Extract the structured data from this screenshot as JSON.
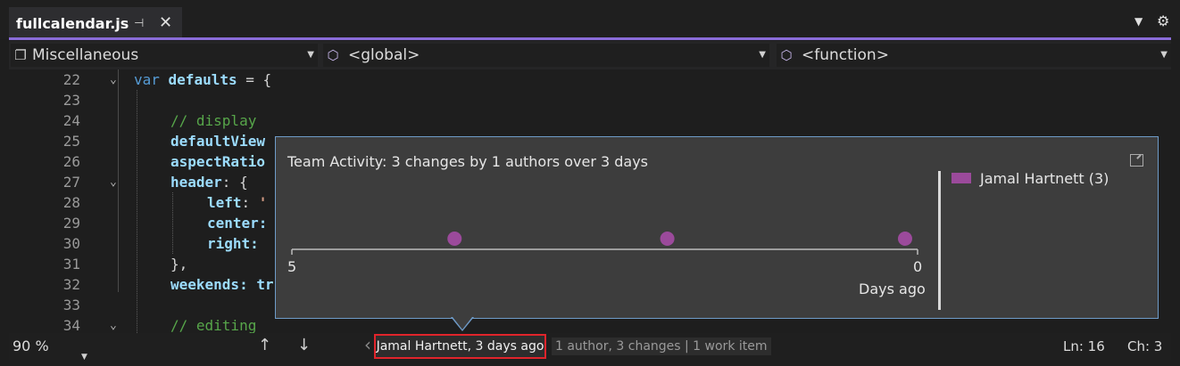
{
  "tab": {
    "title": "fullcalendar.js",
    "pin_icon": "pin-icon",
    "close_icon": "close-icon"
  },
  "toolbar_icons": [
    "dropdown-icon",
    "gear-icon"
  ],
  "navbar": {
    "project": "Miscellaneous",
    "scope": "<global>",
    "member": "<function>"
  },
  "editor": {
    "lines": [
      {
        "n": "22",
        "text": "var defaults = {"
      },
      {
        "n": "23",
        "text": ""
      },
      {
        "n": "24",
        "text": "// display"
      },
      {
        "n": "25",
        "text": "defaultView"
      },
      {
        "n": "26",
        "text": "aspectRatio"
      },
      {
        "n": "27",
        "text": "header: {"
      },
      {
        "n": "28",
        "text": "left: '"
      },
      {
        "n": "29",
        "text": "center:"
      },
      {
        "n": "30",
        "text": "right:"
      },
      {
        "n": "31",
        "text": "},"
      },
      {
        "n": "32",
        "text": "weekends: tr"
      },
      {
        "n": "33",
        "text": ""
      },
      {
        "n": "34",
        "text": "// editing"
      }
    ]
  },
  "popup": {
    "title": "Team Activity: 3 changes by 1 authors over 3 days",
    "legend": [
      {
        "label": "Jamal Hartnett (3)",
        "color": "#9b4a9b"
      }
    ]
  },
  "chart_data": {
    "type": "scatter",
    "title": "Team Activity: 3 changes by 1 authors over 3 days",
    "xlabel": "Days ago",
    "ylabel": "",
    "xlim": [
      5,
      0
    ],
    "x_ticks": [
      "5",
      "0"
    ],
    "series": [
      {
        "name": "Jamal Hartnett (3)",
        "color": "#9b4a9b",
        "x": [
          3.7,
          2.0,
          0.1
        ],
        "y": [
          1,
          1,
          1
        ]
      }
    ],
    "legend_position": "right",
    "grid": false
  },
  "statusbar": {
    "zoom": "90 %",
    "codelens_author": "Jamal Hartnett, 3 days ago",
    "codelens_summary": "1 author, 3 changes | 1 work item",
    "line": "Ln: 16",
    "col": "Ch: 3"
  },
  "colors": {
    "accent": "#8a6cd8",
    "popup_border": "#6e9bc8",
    "highlight_border": "#e0242b"
  }
}
